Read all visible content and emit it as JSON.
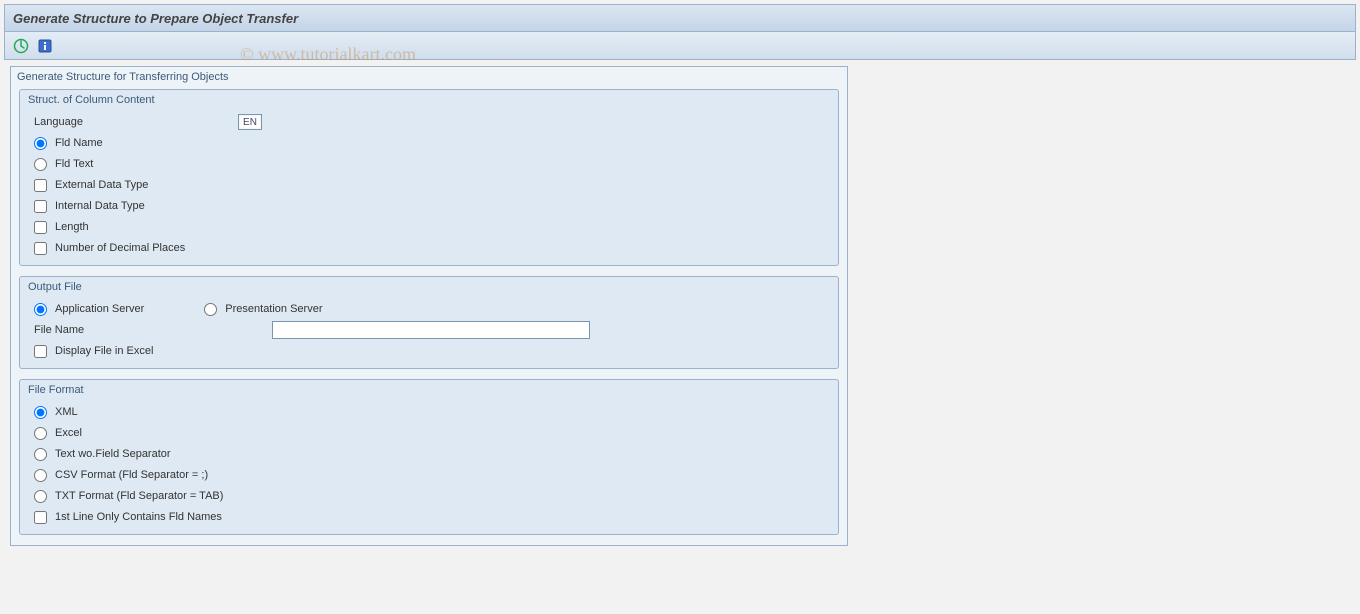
{
  "watermark": "© www.tutorialkart.com",
  "header": {
    "title": "Generate Structure to Prepare Object Transfer"
  },
  "toolbar": {
    "execute_tooltip": "Execute",
    "info_tooltip": "Information"
  },
  "panel": {
    "title": "Generate Structure for Transferring Objects",
    "struct": {
      "title": "Struct. of Column Content",
      "language_label": "Language",
      "language_value": "EN",
      "fld_name": "Fld Name",
      "fld_text": "Fld Text",
      "external_type": "External Data Type",
      "internal_type": "Internal Data Type",
      "length": "Length",
      "decimals": "Number of Decimal Places"
    },
    "output": {
      "title": "Output File",
      "app_server": "Application Server",
      "pres_server": "Presentation Server",
      "file_name_label": "File Name",
      "file_name_value": "",
      "display_excel": "Display File in Excel"
    },
    "format": {
      "title": "File Format",
      "xml": "XML",
      "excel": "Excel",
      "text_no_sep": "Text wo.Field Separator",
      "csv": "CSV Format (Fld Separator = ;)",
      "txt": "TXT Format (Fld Separator = TAB)",
      "first_line": "1st Line Only Contains Fld Names"
    }
  }
}
